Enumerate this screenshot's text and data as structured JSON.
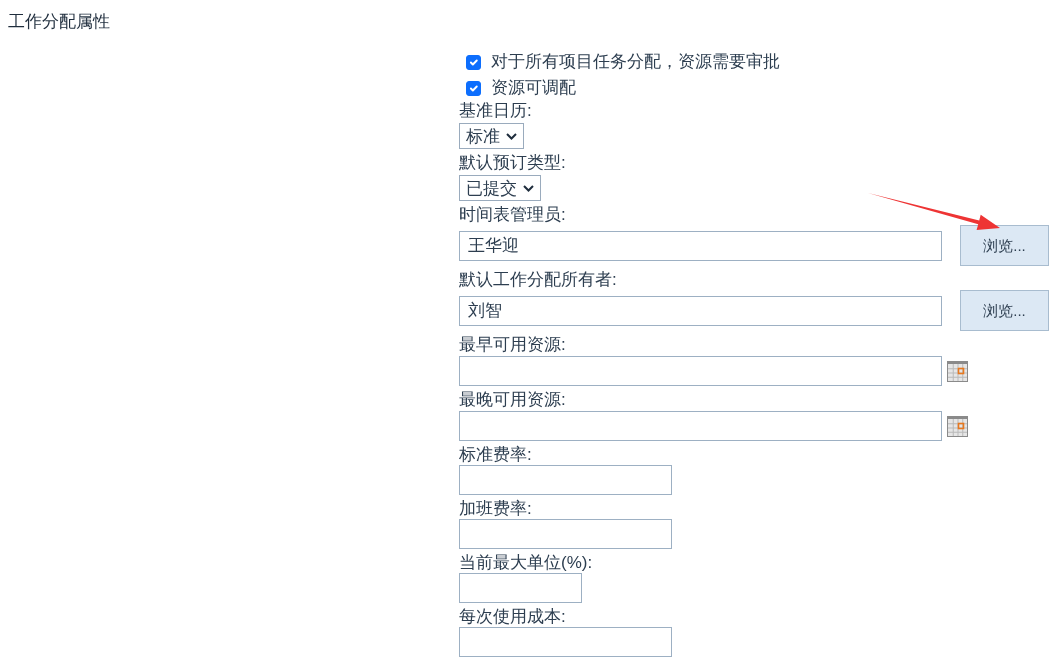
{
  "title": "工作分配属性",
  "checkboxes": [
    {
      "label": "对于所有项目任务分配，资源需要审批",
      "checked": true
    },
    {
      "label": "资源可调配",
      "checked": true
    }
  ],
  "fields": [
    {
      "kind": "select",
      "label": "基准日历:",
      "value": "标准"
    },
    {
      "kind": "select",
      "label": "默认预订类型:",
      "value": "已提交"
    },
    {
      "kind": "picker",
      "label": "时间表管理员:",
      "value": "王华迎",
      "button": "浏览..."
    },
    {
      "kind": "picker",
      "label": "默认工作分配所有者:",
      "value": "刘智",
      "button": "浏览..."
    },
    {
      "kind": "date",
      "label": "最早可用资源:"
    },
    {
      "kind": "date",
      "label": "最晚可用资源:"
    },
    {
      "kind": "text",
      "label": "标准费率:"
    },
    {
      "kind": "text",
      "label": "加班费率:"
    },
    {
      "kind": "short",
      "label": "当前最大单位(%):"
    },
    {
      "kind": "text",
      "label": "每次使用成本:"
    }
  ]
}
